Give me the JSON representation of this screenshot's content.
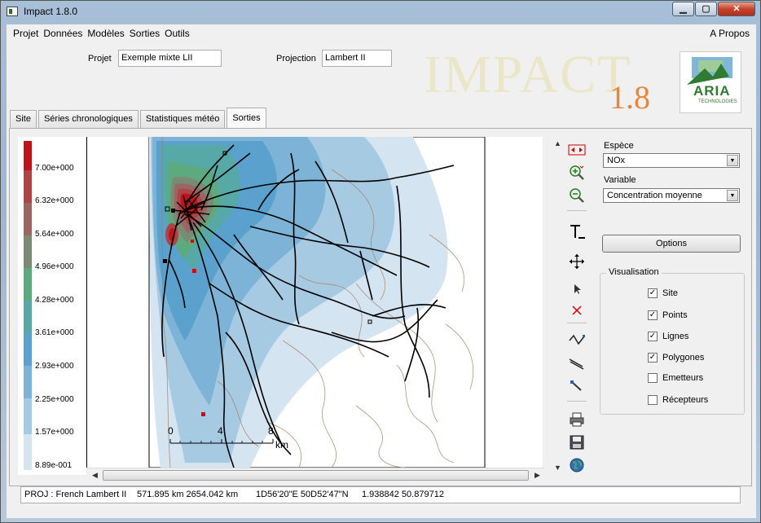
{
  "window": {
    "title": "Impact 1.8.0"
  },
  "menu": {
    "items": [
      "Projet",
      "Données",
      "Modèles",
      "Sorties",
      "Outils"
    ],
    "apropos": "A Propos"
  },
  "header": {
    "projet_label": "Projet",
    "projet_value": "Exemple mixte LII",
    "projection_label": "Projection",
    "projection_value": "Lambert II",
    "logo_text": "IMPACT",
    "logo_version": "1.8",
    "aria_logo": "ARIA",
    "aria_sub": "TECHNOLOGIES"
  },
  "tabs": [
    "Site",
    "Séries chronologiques",
    "Statistiques météo",
    "Sorties"
  ],
  "legend": {
    "labels": [
      "7.00e+000",
      "6.32e+000",
      "5.64e+000",
      "4.96e+000",
      "4.28e+000",
      "3.61e+000",
      "2.93e+000",
      "2.25e+000",
      "1.57e+000",
      "8.89e-001"
    ],
    "colors": [
      "#c0141c",
      "#ad4446",
      "#996661",
      "#7b8a72",
      "#5daa7f",
      "#57a9a8",
      "#5ba1cd",
      "#7cb3d6",
      "#a7cae3",
      "#d4e4f0"
    ]
  },
  "map": {
    "scale_labels": [
      "0",
      "4",
      "8"
    ],
    "scale_unit": "km"
  },
  "controls": {
    "espece_label": "Espèce",
    "espece_value": "NOx",
    "variable_label": "Variable",
    "variable_value": "Concentration moyenne",
    "options_label": "Options",
    "visualisation_title": "Visualisation",
    "checkboxes": [
      {
        "label": "Site",
        "checked": true
      },
      {
        "label": "Points",
        "checked": true
      },
      {
        "label": "Lignes",
        "checked": true
      },
      {
        "label": "Polygones",
        "checked": true
      },
      {
        "label": "Emetteurs",
        "checked": false
      },
      {
        "label": "Récepteurs",
        "checked": false
      }
    ]
  },
  "status": {
    "proj": "PROJ : French Lambert II",
    "km": "571.895 km 2654.042 km",
    "dms": "1D56'20\"E 50D52'47\"N",
    "decimal": "1.938842 50.879712"
  },
  "icons": {
    "zoom_extent": "zoom-extent-icon",
    "zoom_in": "zoom-in-icon",
    "zoom_out": "zoom-out-icon",
    "text": "text-tool-icon",
    "pan": "pan-icon",
    "select": "pointer-icon",
    "delete": "delete-icon",
    "print": "printer-icon",
    "save": "floppy-icon",
    "globe": "globe-icon"
  }
}
